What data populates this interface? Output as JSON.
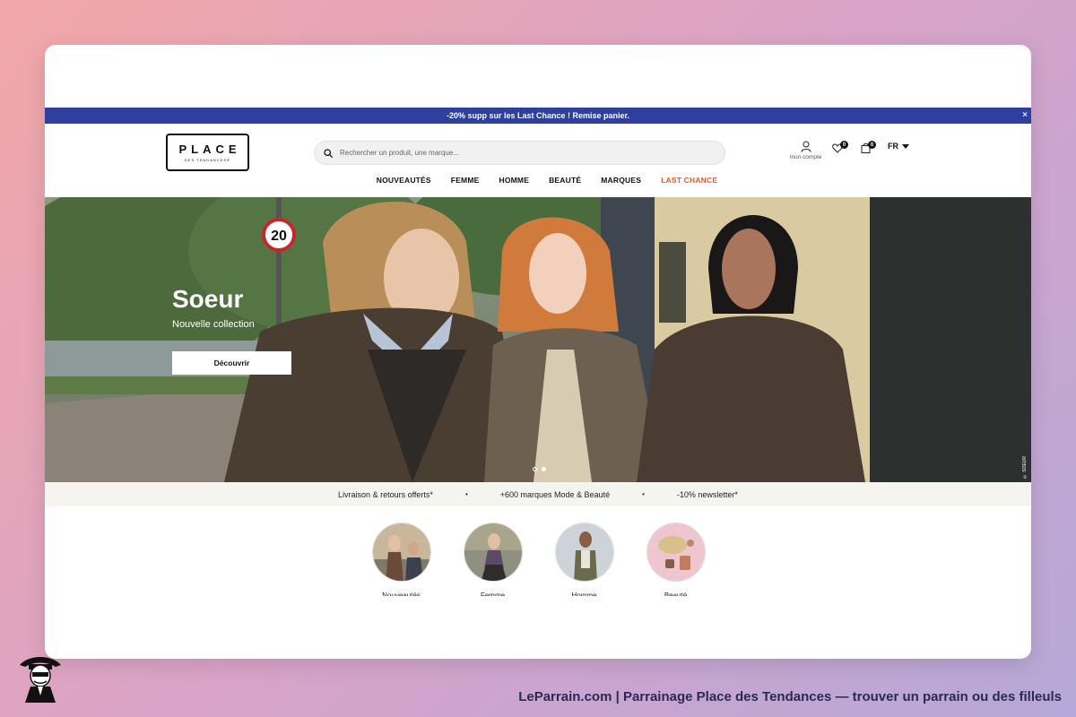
{
  "promo": {
    "text": "-20% supp sur les Last Chance ! Remise panier.",
    "close": "×"
  },
  "logo": {
    "main": "PLACE",
    "sub": "DES TENDANCES®"
  },
  "search": {
    "placeholder": "Rechercher un produit, une marque..."
  },
  "account": {
    "label": "mon compte"
  },
  "wishlist": {
    "count": "0"
  },
  "cart": {
    "count": "0"
  },
  "language": {
    "selected": "FR"
  },
  "nav": [
    {
      "label": "NOUVEAUTÉS"
    },
    {
      "label": "FEMME"
    },
    {
      "label": "HOMME"
    },
    {
      "label": "BEAUTÉ"
    },
    {
      "label": "MARQUES"
    },
    {
      "label": "LAST CHANCE"
    }
  ],
  "hero": {
    "title": "Soeur",
    "subtitle": "Nouvelle collection",
    "cta": "Découvrir",
    "sign": "20",
    "credit": "© SOEUR"
  },
  "benefits": [
    "Livraison & retours offerts*",
    "+600 marques Mode & Beauté",
    "-10% newsletter*"
  ],
  "benefit_separator": "•",
  "categories": [
    {
      "label": "Nouveautés"
    },
    {
      "label": "Femme"
    },
    {
      "label": "Homme"
    },
    {
      "label": "Beauté"
    }
  ],
  "caption": "LeParrain.com | Parrainage Place des Tendances — trouver un parrain ou des filleuls",
  "colors": {
    "promo_bg": "#2f3f9e",
    "accent": "#e06030",
    "benefits_bg": "#f6f4ef"
  }
}
